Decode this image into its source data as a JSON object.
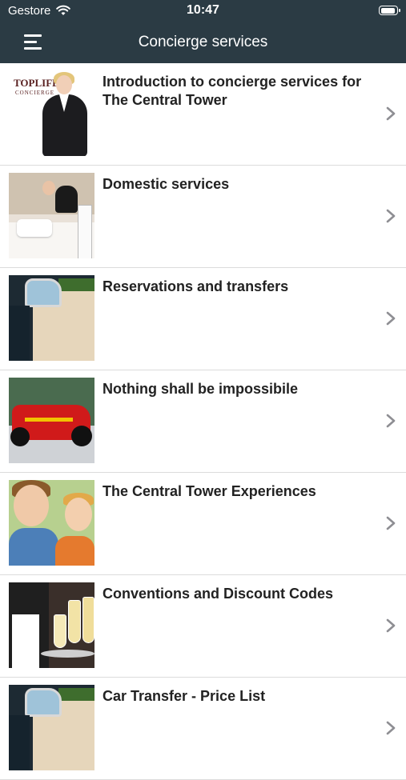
{
  "status_bar": {
    "carrier": "Gestore",
    "time": "10:47",
    "battery_level": 0.9
  },
  "nav": {
    "title": "Concierge services",
    "menu_icon": "hamburger-menu-icon"
  },
  "items": [
    {
      "title": "Introduction to concierge services for The Central Tower",
      "thumb_text_1": "TOPLIFE",
      "thumb_text_2": "CONCIERGE"
    },
    {
      "title": "Domestic services"
    },
    {
      "title": "Reservations and transfers"
    },
    {
      "title": "Nothing shall be impossibile"
    },
    {
      "title": "The Central Tower Experiences"
    },
    {
      "title": "Conventions and Discount Codes"
    },
    {
      "title": "Car Transfer - Price List"
    }
  ],
  "colors": {
    "header_bg": "#2b3b44",
    "header_text": "#ffffff",
    "row_title": "#222222",
    "chevron": "#8e8e93",
    "divider": "#dcdcdc"
  }
}
